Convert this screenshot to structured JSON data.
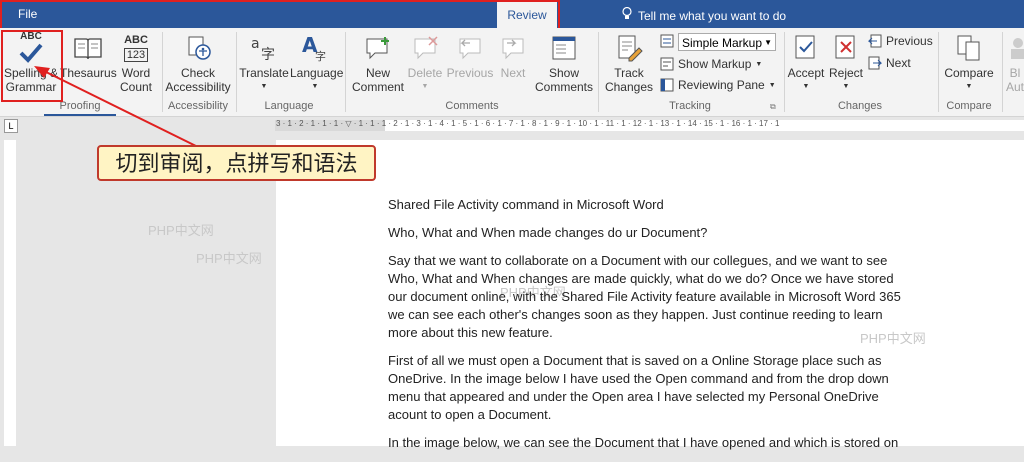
{
  "tabs": {
    "file": "File",
    "review": "Review"
  },
  "tell_me": "Tell me what you want to do",
  "ribbon": {
    "proofing": {
      "group": "Proofing",
      "spelling": {
        "line1": "Spelling &",
        "line2": "Grammar",
        "icon_text": "ABC"
      },
      "thesaurus": "Thesaurus",
      "word_count": {
        "line1": "Word",
        "line2": "Count",
        "icon_text1": "ABC",
        "icon_text2": "123"
      }
    },
    "accessibility": {
      "group": "Accessibility",
      "check": {
        "line1": "Check",
        "line2": "Accessibility"
      }
    },
    "language": {
      "group": "Language",
      "translate": "Translate",
      "language": "Language"
    },
    "comments": {
      "group": "Comments",
      "new": {
        "line1": "New",
        "line2": "Comment"
      },
      "delete": "Delete",
      "previous": "Previous",
      "next": "Next",
      "show": {
        "line1": "Show",
        "line2": "Comments"
      }
    },
    "tracking": {
      "group": "Tracking",
      "track": {
        "line1": "Track",
        "line2": "Changes"
      },
      "markup_select": "Simple Markup",
      "show_markup": "Show Markup",
      "reviewing_pane": "Reviewing Pane"
    },
    "changes": {
      "group": "Changes",
      "accept": "Accept",
      "reject": "Reject",
      "previous": "Previous",
      "next": "Next"
    },
    "compare": {
      "group": "Compare",
      "compare": "Compare",
      "extra": "Bl",
      "extra2": "Aut"
    }
  },
  "ruler_numbers": "3 · 1 · 2 · 1 · 1 · 1 · ▽ · 1 · 1 · 1 · 2 · 1 · 3 · 1 · 4 · 1 · 5 · 1 · 6 · 1 · 7 · 1 · 8 · 1 · 9 · 1 · 10 · 1 · 11 · 1 · 12 · 1 · 13 · 1 · 14 · 15 · 1 · 16 · 1 · 17 · 1",
  "callout": "切到审阅，点拼写和语法",
  "watermarks": [
    "PHP中文网",
    "PHP中文网",
    "PHP中文网",
    "PHP中文网"
  ],
  "document": {
    "title": "Shared File Activity command in Microsoft Word",
    "question": "Who, What and When made changes do ur Document?",
    "para1": "Say that we want to collaborate on a Document with our collegues, and we want to see Who, What and When changes are made quickly, what do we do?  Once we have stored our document online, with the Shared File Activity feature available in Microsoft Word 365 we can see each other's changes soon as they happen.  Just continue reeding to learn more about this new feature.",
    "para2": "First of all we must open a Document that is saved on a Online Storage place such as OneDrive.  In the image below I have used the Open command and from the drop down menu that appeared and under the Open area I have selected my Personal OneDrive acount to open a Document.",
    "para3": " In the image below, we can see the Document that I have opened and which is stored on"
  }
}
